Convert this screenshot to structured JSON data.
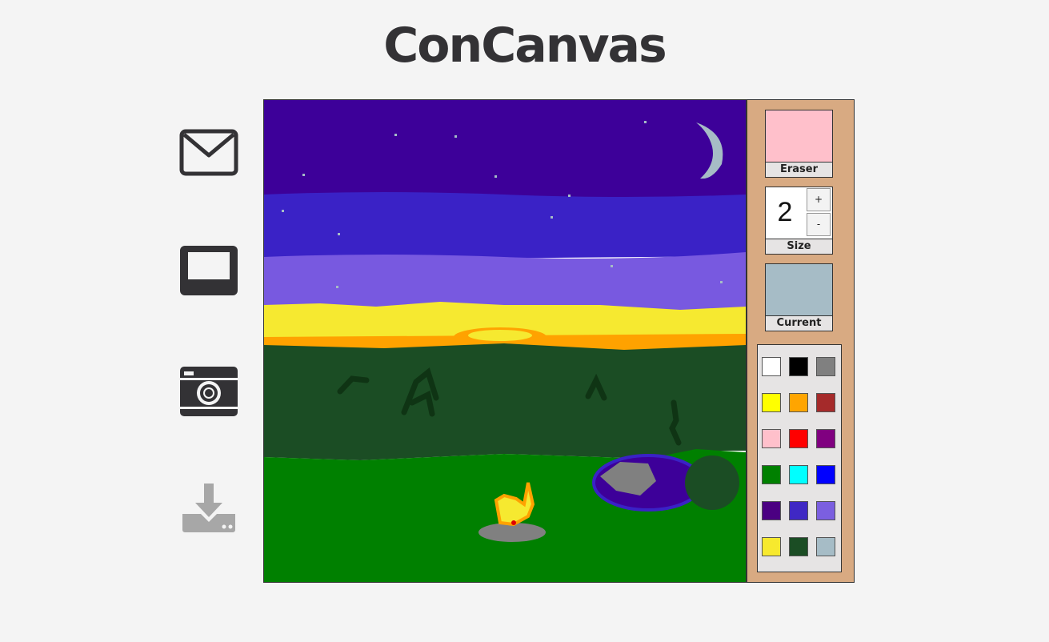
{
  "app": {
    "title": "ConCanvas"
  },
  "sidebar": {
    "icons": [
      {
        "name": "mail-icon"
      },
      {
        "name": "screen-icon"
      },
      {
        "name": "camera-icon"
      },
      {
        "name": "download-icon"
      }
    ]
  },
  "tools": {
    "eraser": {
      "label": "Eraser",
      "color": "#ffc0cb"
    },
    "size": {
      "label": "Size",
      "value": "2",
      "plus_label": "+",
      "minus_label": "-"
    },
    "current": {
      "label": "Current",
      "color": "#a6bcc6"
    }
  },
  "palette": {
    "colors": [
      "#ffffff",
      "#000000",
      "#808080",
      "#ffff00",
      "#ffa500",
      "#a52a2a",
      "#ffc0cb",
      "#ff0000",
      "#800080",
      "#008000",
      "#00ffff",
      "#0000ff",
      "#4b0082",
      "#3f28c4",
      "#7b5fe0",
      "#f7e92e",
      "#1b4d24",
      "#a6bcc6"
    ]
  }
}
